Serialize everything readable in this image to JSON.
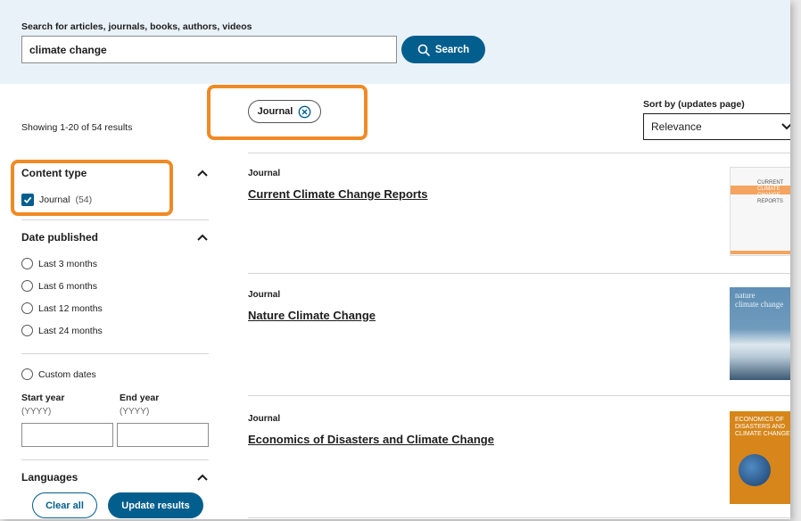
{
  "search": {
    "label": "Search for articles, journals, books, authors, videos",
    "value": "climate change",
    "button_label": "Search"
  },
  "results_summary": "Showing 1-20 of 54 results",
  "active_filter": {
    "label": "Journal"
  },
  "sort": {
    "label": "Sort by (updates page)",
    "selected": "Relevance"
  },
  "facets": {
    "content_type": {
      "title": "Content type",
      "options": [
        {
          "label": "Journal",
          "count": "(54)",
          "checked": true
        }
      ]
    },
    "date_published": {
      "title": "Date published",
      "options": [
        "Last 3 months",
        "Last 6 months",
        "Last 12 months",
        "Last 24 months"
      ],
      "custom_label": "Custom dates",
      "start_year_label": "Start year",
      "start_year_hint": "(YYYY)",
      "end_year_label": "End year",
      "end_year_hint": "(YYYY)"
    },
    "languages": {
      "title": "Languages"
    }
  },
  "actions": {
    "clear_label": "Clear all",
    "update_label": "Update results"
  },
  "results": [
    {
      "type": "Journal",
      "title": "Current Climate Change Reports",
      "cover": {
        "lines": [
          "CURRENT",
          "CLIMATE",
          "CHANGE",
          "REPORTS"
        ],
        "accent": "#f4a460"
      }
    },
    {
      "type": "Journal",
      "title": "Nature Climate Change",
      "cover": {
        "lines": [
          "nature",
          "climate change"
        ],
        "accent": "#6f9bbd"
      }
    },
    {
      "type": "Journal",
      "title": "Economics of Disasters and Climate Change",
      "cover": {
        "lines": [
          "ECONOMICS OF",
          "DISASTERS AND",
          "CLIMATE CHANGE"
        ],
        "accent": "#d6861a"
      }
    }
  ],
  "colors": {
    "primary": "#025e8d",
    "highlight": "#f08a24",
    "search_band": "#eaf2f9"
  }
}
